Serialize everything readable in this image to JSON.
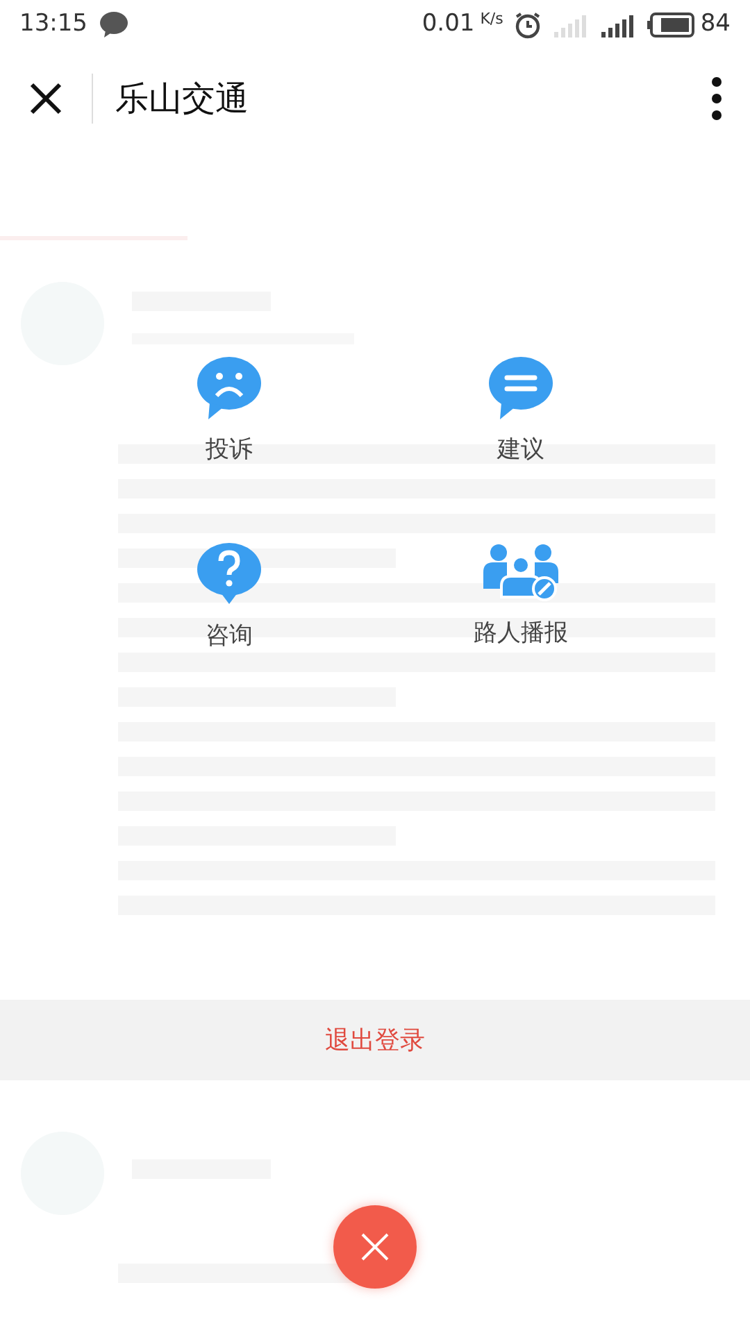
{
  "status_bar": {
    "time": "13:15",
    "speed": "0.01",
    "speed_unit": "K/s",
    "battery": "84"
  },
  "header": {
    "title": "乐山交通"
  },
  "menu": [
    {
      "label": "投诉",
      "kind": "sad"
    },
    {
      "label": "建议",
      "kind": "lines"
    },
    {
      "label": "咨询",
      "kind": "question"
    },
    {
      "label": "路人播报",
      "kind": "people"
    }
  ],
  "logout": {
    "label": "退出登录"
  }
}
